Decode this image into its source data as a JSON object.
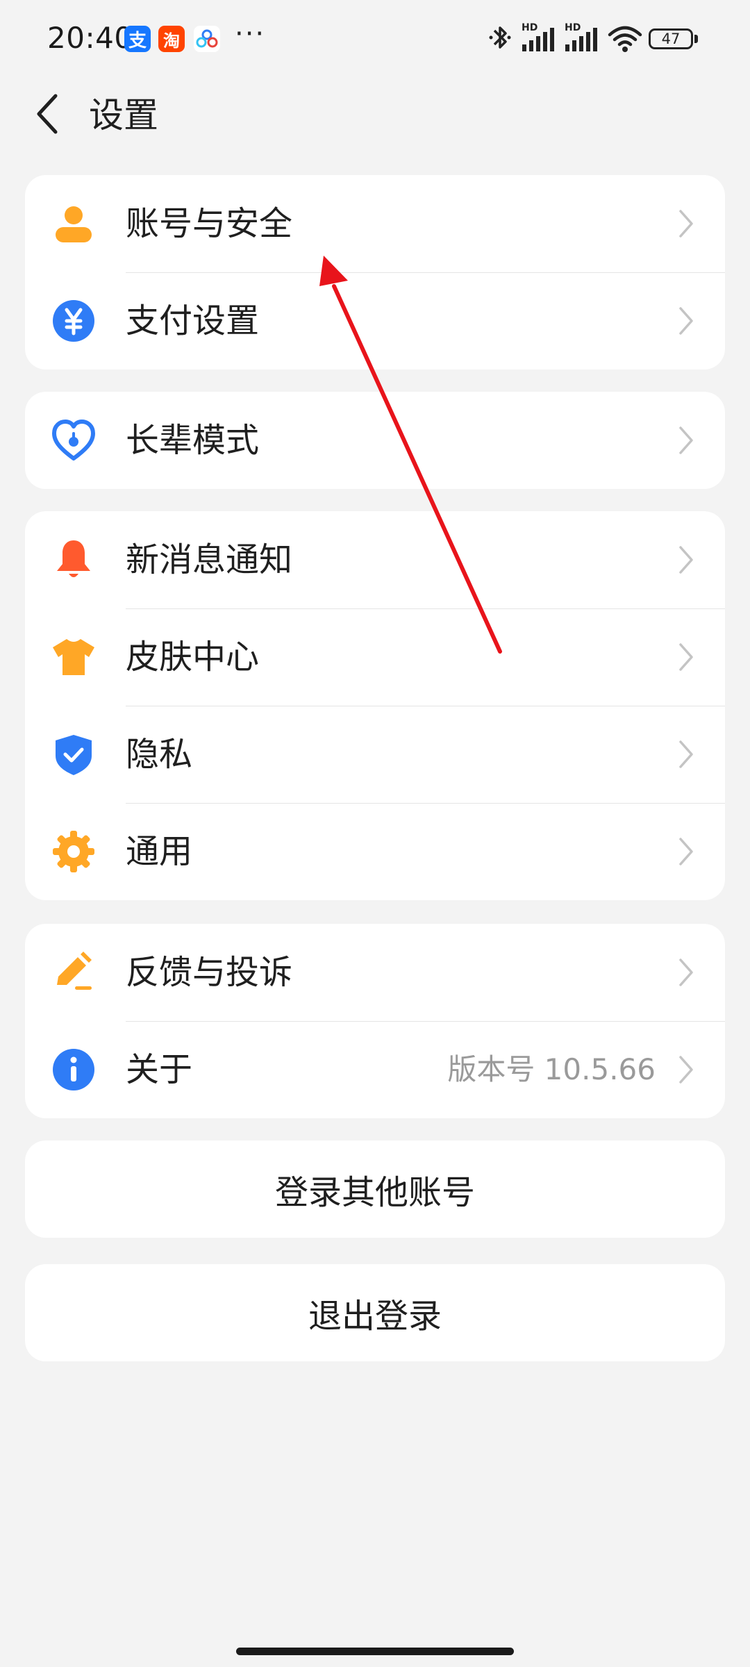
{
  "status_bar": {
    "time": "20:40",
    "apps": [
      "alipay-icon",
      "taobao-icon",
      "baidu-netdisk-icon"
    ],
    "alipay_glyph": "支",
    "taobao_glyph": "淘",
    "more": "···",
    "battery": "47",
    "signal_label": "HD"
  },
  "header": {
    "title": "设置",
    "back_icon": "chevron-left-icon"
  },
  "groups": [
    {
      "items": [
        {
          "label": "账号与安全",
          "icon": "person-icon",
          "color": "#FFA726"
        },
        {
          "label": "支付设置",
          "icon": "yuan-icon",
          "color": "#2F7CF6"
        }
      ]
    },
    {
      "items": [
        {
          "label": "长辈模式",
          "icon": "heart-icon",
          "color": "#2F7CF6"
        }
      ]
    },
    {
      "items": [
        {
          "label": "新消息通知",
          "icon": "bell-icon",
          "color": "#FF5A2E"
        },
        {
          "label": "皮肤中心",
          "icon": "tshirt-icon",
          "color": "#FFA726"
        },
        {
          "label": "隐私",
          "icon": "shield-icon",
          "color": "#2F7CF6"
        },
        {
          "label": "通用",
          "icon": "gear-icon",
          "color": "#FFA726"
        }
      ]
    },
    {
      "items": [
        {
          "label": "反馈与投诉",
          "icon": "pencil-icon",
          "color": "#FFA726"
        },
        {
          "label": "关于",
          "icon": "info-icon",
          "color": "#2F7CF6",
          "value": "版本号 10.5.66"
        }
      ]
    }
  ],
  "buttons": {
    "switch_account": "登录其他账号",
    "logout": "退出登录"
  },
  "annotation": {
    "type": "arrow",
    "color": "#E8141B"
  }
}
